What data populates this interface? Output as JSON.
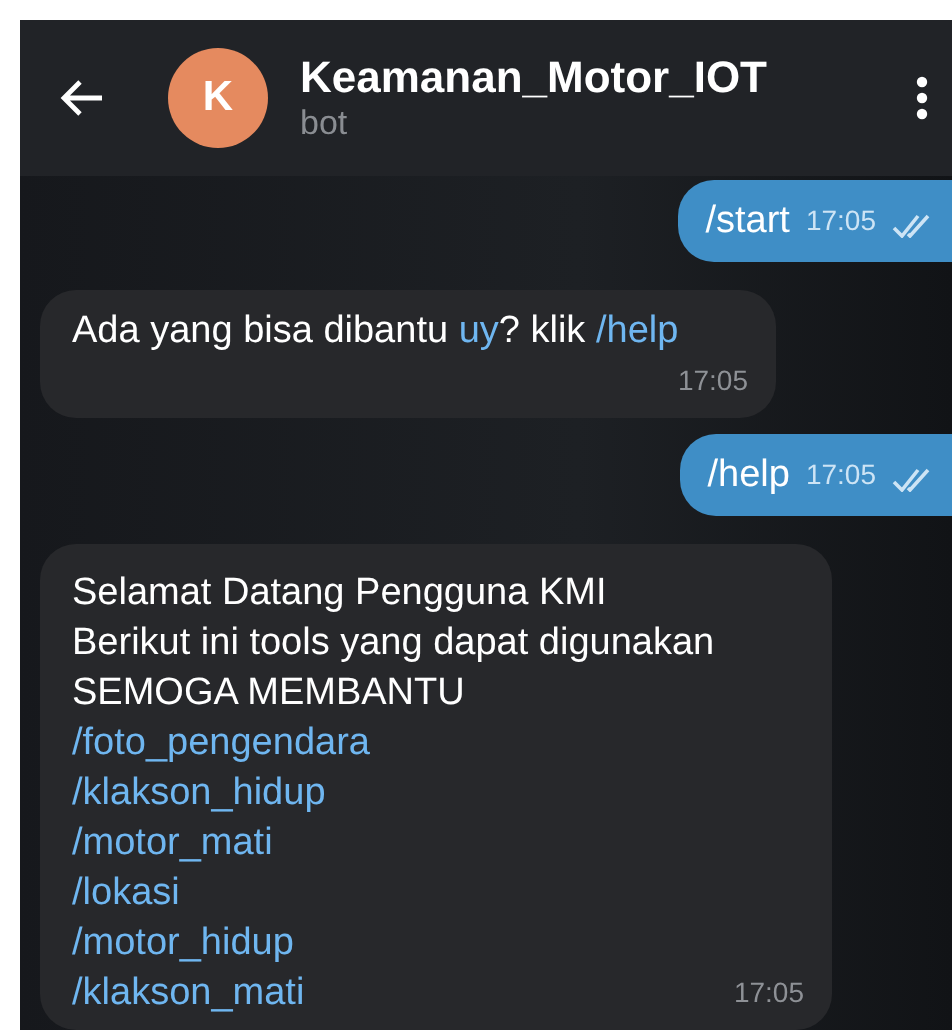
{
  "header": {
    "avatar_letter": "K",
    "title": "Keamanan_Motor_IOT",
    "subtitle": "bot"
  },
  "messages": [
    {
      "kind": "outgoing",
      "text": "/start",
      "time": "17:05",
      "read": true
    },
    {
      "kind": "incoming",
      "segments": [
        {
          "text": "Ada yang bisa dibantu ",
          "link": false
        },
        {
          "text": "uy",
          "link": true
        },
        {
          "text": "? klik ",
          "link": false
        },
        {
          "text": "/help",
          "link": true
        }
      ],
      "time": "17:05"
    },
    {
      "kind": "outgoing",
      "text": "/help",
      "time": "17:05",
      "read": true
    },
    {
      "kind": "incoming",
      "lines": [
        {
          "text": "Selamat Datang Pengguna KMI",
          "link": false
        },
        {
          "text": "Berikut ini tools yang dapat digunakan",
          "link": false
        },
        {
          "text": "SEMOGA MEMBANTU",
          "link": false
        },
        {
          "text": "/foto_pengendara",
          "link": true
        },
        {
          "text": "/klakson_hidup",
          "link": true
        },
        {
          "text": "/motor_mati",
          "link": true
        },
        {
          "text": "/lokasi",
          "link": true
        },
        {
          "text": "/motor_hidup",
          "link": true
        },
        {
          "text": "/klakson_mati",
          "link": true
        }
      ],
      "time": "17:05"
    }
  ]
}
